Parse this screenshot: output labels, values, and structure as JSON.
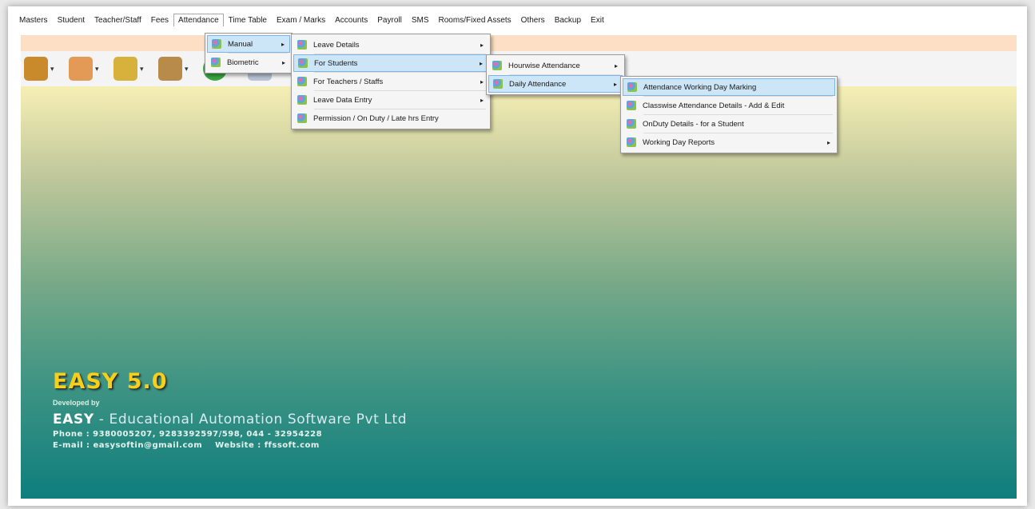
{
  "menubar": [
    "Masters",
    "Student",
    "Teacher/Staff",
    "Fees",
    "Attendance",
    "Time Table",
    "Exam / Marks",
    "Accounts",
    "Payroll",
    "SMS",
    "Rooms/Fixed Assets",
    "Others",
    "Backup",
    "Exit"
  ],
  "menus": {
    "attendance": [
      {
        "label": "Manual",
        "submenu": true,
        "highlighted": true
      },
      {
        "label": "Biometric",
        "submenu": true,
        "highlighted": false
      }
    ],
    "manual": [
      {
        "label": "Leave Details",
        "submenu": true,
        "highlighted": false
      },
      {
        "label": "For Students",
        "submenu": true,
        "highlighted": true
      },
      {
        "label": "For Teachers / Staffs",
        "submenu": true,
        "highlighted": false
      },
      {
        "label": "Leave Data Entry",
        "submenu": true,
        "highlighted": false
      },
      {
        "label": "Permission / On Duty / Late hrs Entry",
        "submenu": false,
        "highlighted": false
      }
    ],
    "for_students": [
      {
        "label": "Hourwise Attendance",
        "submenu": true,
        "highlighted": false
      },
      {
        "label": "Daily Attendance",
        "submenu": true,
        "highlighted": true
      }
    ],
    "daily_attendance": [
      {
        "label": "Attendance Working Day Marking",
        "submenu": false,
        "highlighted": true
      },
      {
        "label": "Classwise Attendance Details - Add & Edit",
        "submenu": false,
        "highlighted": false
      },
      {
        "label": "OnDuty Details - for a Student",
        "submenu": false,
        "highlighted": false
      },
      {
        "label": "Working Day Reports",
        "submenu": true,
        "highlighted": false
      }
    ]
  },
  "submenu_arrow": "▸",
  "toolbar": [
    {
      "icon": "gift-icon",
      "color": "#c98a2c",
      "dropdown": "▾"
    },
    {
      "icon": "people-icon",
      "color": "#e39a57",
      "dropdown": "▾"
    },
    {
      "icon": "staff-icon",
      "color": "#d6b13c",
      "dropdown": "▾"
    },
    {
      "icon": "money-stack-icon",
      "color": "#b88b4a",
      "dropdown": "▾"
    },
    {
      "icon": "refresh-icon",
      "color": "#3aa640",
      "dropdown": ""
    },
    {
      "icon": "calendar-icon",
      "color": "#b9c3d4",
      "dropdown": ""
    }
  ],
  "brand": {
    "title": "EASY 5.0",
    "developed_by": "Developed by",
    "company_bold": "EASY",
    "company_rest": " - Educational Automation Software Pvt Ltd",
    "phone": "Phone : 9380005207, 9283392597/598,  044 - 32954228",
    "email": "E-mail : easysoftin@gmail.com",
    "website": "Website : ffssoft.com"
  },
  "colors": {
    "highlight": "#cde6f7",
    "brand_title": "#f6cf1c",
    "strip": "#fcdfc4"
  }
}
